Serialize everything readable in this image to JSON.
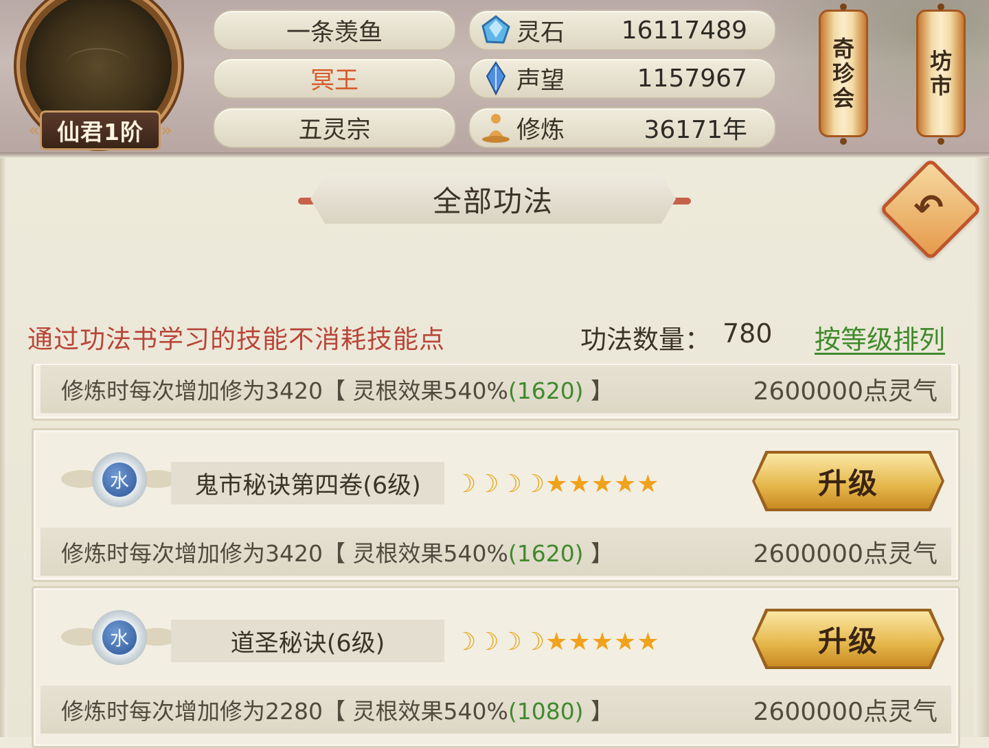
{
  "profile": {
    "rank_badge": "仙君1阶",
    "name": "一条羡鱼",
    "title": "冥王",
    "sect": "五灵宗"
  },
  "stats": [
    {
      "icon": "spirit-stone-icon",
      "label": "灵石",
      "value": "16117489"
    },
    {
      "icon": "prestige-crystal-icon",
      "label": "声望",
      "value": "1157967"
    },
    {
      "icon": "meditation-icon",
      "label": "修炼",
      "value": "36171年"
    }
  ],
  "shortcuts": {
    "treasure_hall": "奇珍会",
    "market": "坊市"
  },
  "panel": {
    "title": "全部功法",
    "back_icon": "back-arrow-icon",
    "notice": "通过功法书学习的技能不消耗技能点",
    "count_label": "功法数量：",
    "count_value": "780",
    "sort_label": "按等级排列"
  },
  "skills": [
    {
      "element": "",
      "name": "",
      "moons": 0,
      "stars": 0,
      "upgrade_label": "",
      "desc_prefix": "修炼时每次增加修为3420【 灵根效果540%",
      "desc_bonus": "(1620)",
      "desc_suffix": " 】",
      "cost": "2600000点灵气"
    },
    {
      "element": "水",
      "name": "鬼市秘诀第四卷(6级)",
      "moons": 4,
      "stars": 5,
      "upgrade_label": "升级",
      "desc_prefix": "修炼时每次增加修为3420【 灵根效果540%",
      "desc_bonus": "(1620)",
      "desc_suffix": " 】",
      "cost": "2600000点灵气"
    },
    {
      "element": "水",
      "name": "道圣秘诀(6级)",
      "moons": 4,
      "stars": 5,
      "upgrade_label": "升级",
      "desc_prefix": "修炼时每次增加修为2280【 灵根效果540%",
      "desc_bonus": "(1080)",
      "desc_suffix": " 】",
      "cost": "2600000点灵气"
    }
  ],
  "colors": {
    "notice": "#b84538",
    "sort_link": "#3f8a2c",
    "title_highlight": "#d55a2a",
    "bonus_green": "#3f8a2c"
  }
}
